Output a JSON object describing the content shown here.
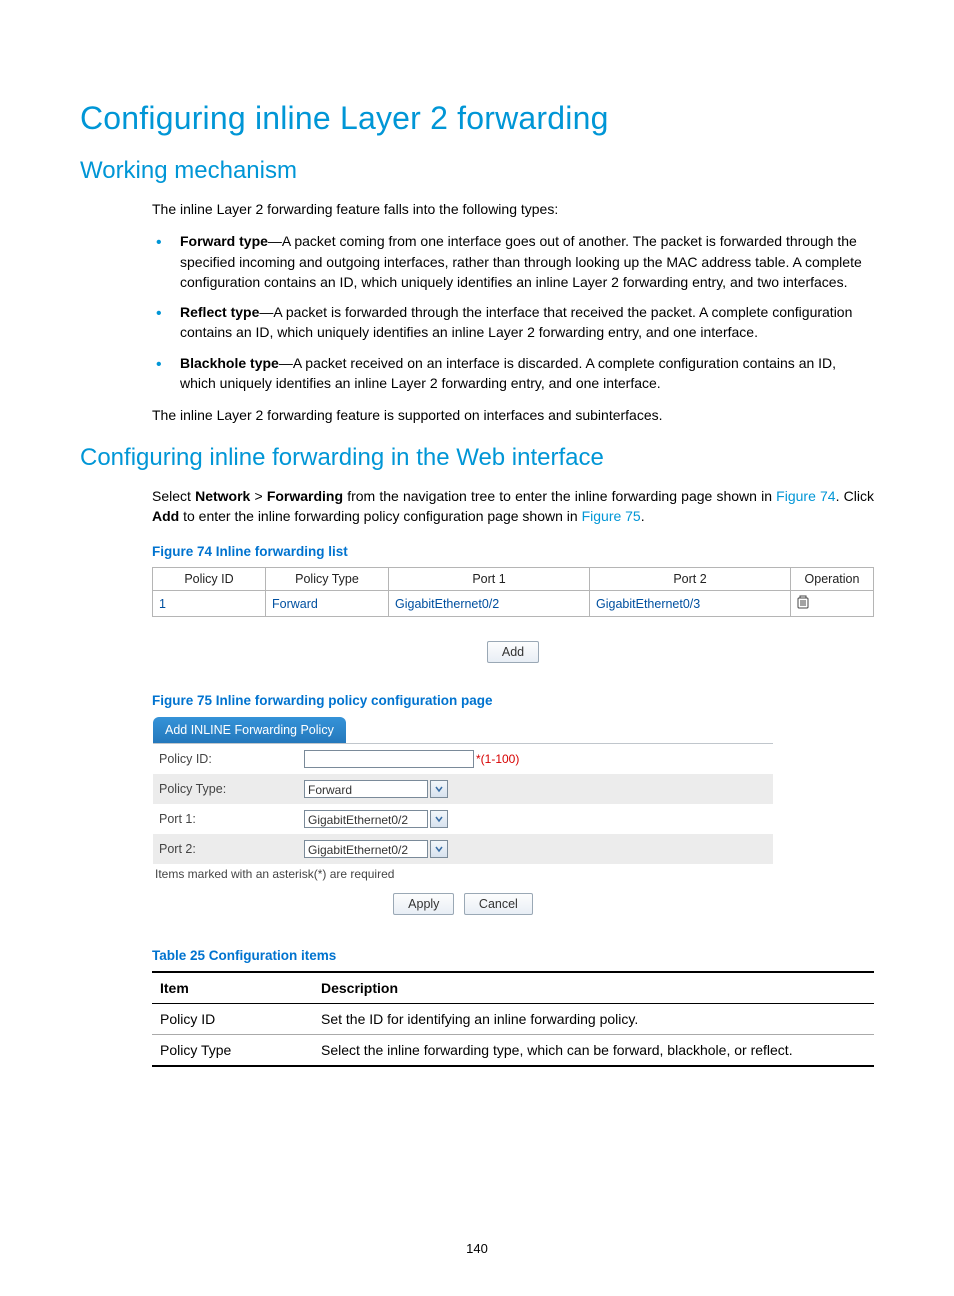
{
  "h1": "Configuring inline Layer 2 forwarding",
  "h2a": "Working mechanism",
  "intro": "The inline Layer 2 forwarding feature falls into the following types:",
  "bullets": {
    "b1_label": "Forward type",
    "b1_text": "—A packet coming from one interface goes out of another. The packet is forwarded through the specified incoming and outgoing interfaces, rather than through looking up the MAC address table. A complete configuration contains an ID, which uniquely identifies an inline Layer 2 forwarding entry, and two interfaces.",
    "b2_label": "Reflect type",
    "b2_text": "—A packet is forwarded through the interface that received the packet. A complete configuration contains an ID, which uniquely identifies an inline Layer 2 forwarding entry, and one interface.",
    "b3_label": "Blackhole type",
    "b3_text": "—A packet received on an interface is discarded. A complete configuration contains an ID, which uniquely identifies an inline Layer 2 forwarding entry, and one interface."
  },
  "after_bullets": "The inline Layer 2 forwarding feature is supported on interfaces and subinterfaces.",
  "h2b": "Configuring inline forwarding in the Web interface",
  "para2": {
    "p1": "Select ",
    "nw": "Network",
    "gt": " > ",
    "fw": "Forwarding",
    "p2": " from the navigation tree to enter the inline forwarding page shown in ",
    "fig74": "Figure 74",
    "p3": ". Click ",
    "addb": "Add",
    "p4": " to enter the inline forwarding policy configuration page shown in ",
    "fig75": "Figure 75",
    "p5": "."
  },
  "fig74_cap": "Figure 74 Inline forwarding list",
  "fwd_headers": {
    "c1": "Policy ID",
    "c2": "Policy Type",
    "c3": "Port 1",
    "c4": "Port 2",
    "c5": "Operation"
  },
  "fwd_row": {
    "c1": "1",
    "c2": "Forward",
    "c3": "GigabitEthernet0/2",
    "c4": "GigabitEthernet0/3"
  },
  "add_btn": "Add",
  "fig75_cap": "Figure 75 Inline forwarding policy configuration page",
  "form": {
    "tab": "Add INLINE Forwarding Policy",
    "policy_id_label": "Policy ID:",
    "policy_id_hint": "*(1-100)",
    "policy_type_label": "Policy Type:",
    "policy_type_val": "Forward",
    "port1_label": "Port 1:",
    "port1_val": "GigabitEthernet0/2",
    "port2_label": "Port 2:",
    "port2_val": "GigabitEthernet0/2",
    "req_note": "Items marked with an asterisk(*) are required",
    "apply": "Apply",
    "cancel": "Cancel"
  },
  "table25_cap": "Table 25 Configuration items",
  "table25": {
    "h1": "Item",
    "h2": "Description",
    "r1c1": "Policy ID",
    "r1c2": "Set the ID for identifying an inline forwarding policy.",
    "r2c1": "Policy Type",
    "r2c2": "Select the inline forwarding type, which can be forward, blackhole, or reflect."
  },
  "page_num": "140"
}
